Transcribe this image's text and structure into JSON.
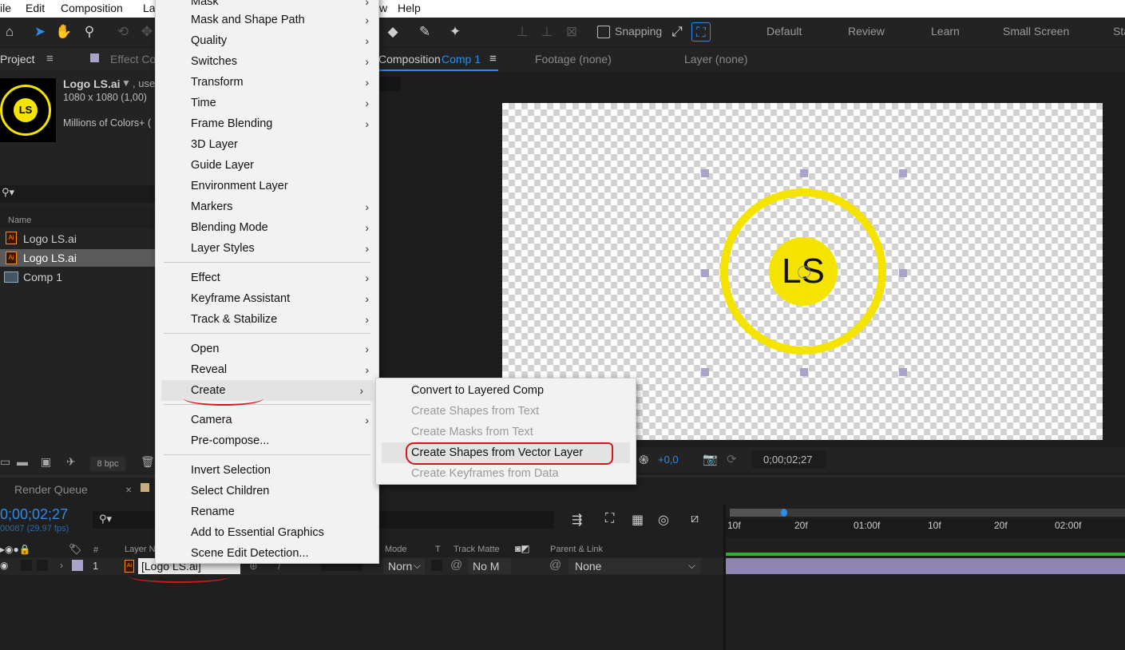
{
  "menubar": {
    "items": [
      "ile",
      "Edit",
      "Composition",
      "La",
      "w",
      "Help"
    ]
  },
  "toolbar": {
    "snapping_label": "Snapping",
    "workspaces": [
      "Default",
      "Review",
      "Learn",
      "Small Screen",
      "Sta"
    ]
  },
  "project_panel": {
    "tab": "Project",
    "effect_tab": "Effect Co",
    "item_name": "Logo LS.ai",
    "item_used": ", use",
    "dimensions": "1080 x 1080 (1,00)",
    "colors": "Millions of Colors+ (",
    "thumbnail_text": "LS",
    "column_name": "Name",
    "items": [
      "Logo LS.ai",
      "Logo LS.ai",
      "Comp 1"
    ],
    "bpc": "8 bpc"
  },
  "comp_panel": {
    "tab_prefix": "Composition",
    "tab_name": "Comp 1",
    "footage": "Footage  (none)",
    "layer": "Layer  (none)",
    "logo_text": "LS",
    "exposure": "+0,0",
    "timecode": "0;00;02;27"
  },
  "timeline": {
    "render_queue": "Render Queue",
    "timecode": "0;00;02;27",
    "frames": "00087 (29.97 fps)",
    "col_hash": "#",
    "col_layer": "Layer N",
    "col_mode": "Mode",
    "col_t": "T",
    "col_track": "Track Matte",
    "col_parent": "Parent & Link",
    "layer_index": "1",
    "layer_name": "[Logo LS.ai]",
    "mode_value": "Norn",
    "matte_value": "No M",
    "parent_value": "None",
    "ruler": [
      "10f",
      "20f",
      "01:00f",
      "10f",
      "20f",
      "02:00f"
    ]
  },
  "context_menu": {
    "items": [
      {
        "label": "Mask",
        "submenu": true
      },
      {
        "label": "Mask and Shape Path",
        "submenu": true
      },
      {
        "label": "Quality",
        "submenu": true
      },
      {
        "label": "Switches",
        "submenu": true
      },
      {
        "label": "Transform",
        "submenu": true
      },
      {
        "label": "Time",
        "submenu": true
      },
      {
        "label": "Frame Blending",
        "submenu": true
      },
      {
        "label": "3D Layer",
        "submenu": false
      },
      {
        "label": "Guide Layer",
        "submenu": false
      },
      {
        "label": "Environment Layer",
        "submenu": false
      },
      {
        "label": "Markers",
        "submenu": true
      },
      {
        "label": "Blending Mode",
        "submenu": true
      },
      {
        "label": "Layer Styles",
        "submenu": true
      },
      {
        "label": "Effect",
        "submenu": true
      },
      {
        "label": "Keyframe Assistant",
        "submenu": true
      },
      {
        "label": "Track & Stabilize",
        "submenu": true
      },
      {
        "label": "Open",
        "submenu": true
      },
      {
        "label": "Reveal",
        "submenu": true
      },
      {
        "label": "Create",
        "submenu": true
      },
      {
        "label": "Camera",
        "submenu": true
      },
      {
        "label": "Pre-compose...",
        "submenu": false
      },
      {
        "label": "Invert Selection",
        "submenu": false
      },
      {
        "label": "Select Children",
        "submenu": false
      },
      {
        "label": "Rename",
        "submenu": false
      },
      {
        "label": "Add to Essential Graphics",
        "submenu": false
      },
      {
        "label": "Scene Edit Detection...",
        "submenu": false
      }
    ]
  },
  "create_submenu": {
    "items": [
      {
        "label": "Convert to Layered Comp",
        "enabled": true
      },
      {
        "label": "Create Shapes from Text",
        "enabled": false
      },
      {
        "label": "Create Masks from Text",
        "enabled": false
      },
      {
        "label": "Create Shapes from Vector Layer",
        "enabled": true
      },
      {
        "label": "Create Keyframes from Data",
        "enabled": false
      }
    ]
  },
  "colors": {
    "accent": "#2d8ceb",
    "logo_yellow": "#f5e400",
    "annotation_red": "#d21919",
    "layer_bar": "#8e86b0"
  }
}
